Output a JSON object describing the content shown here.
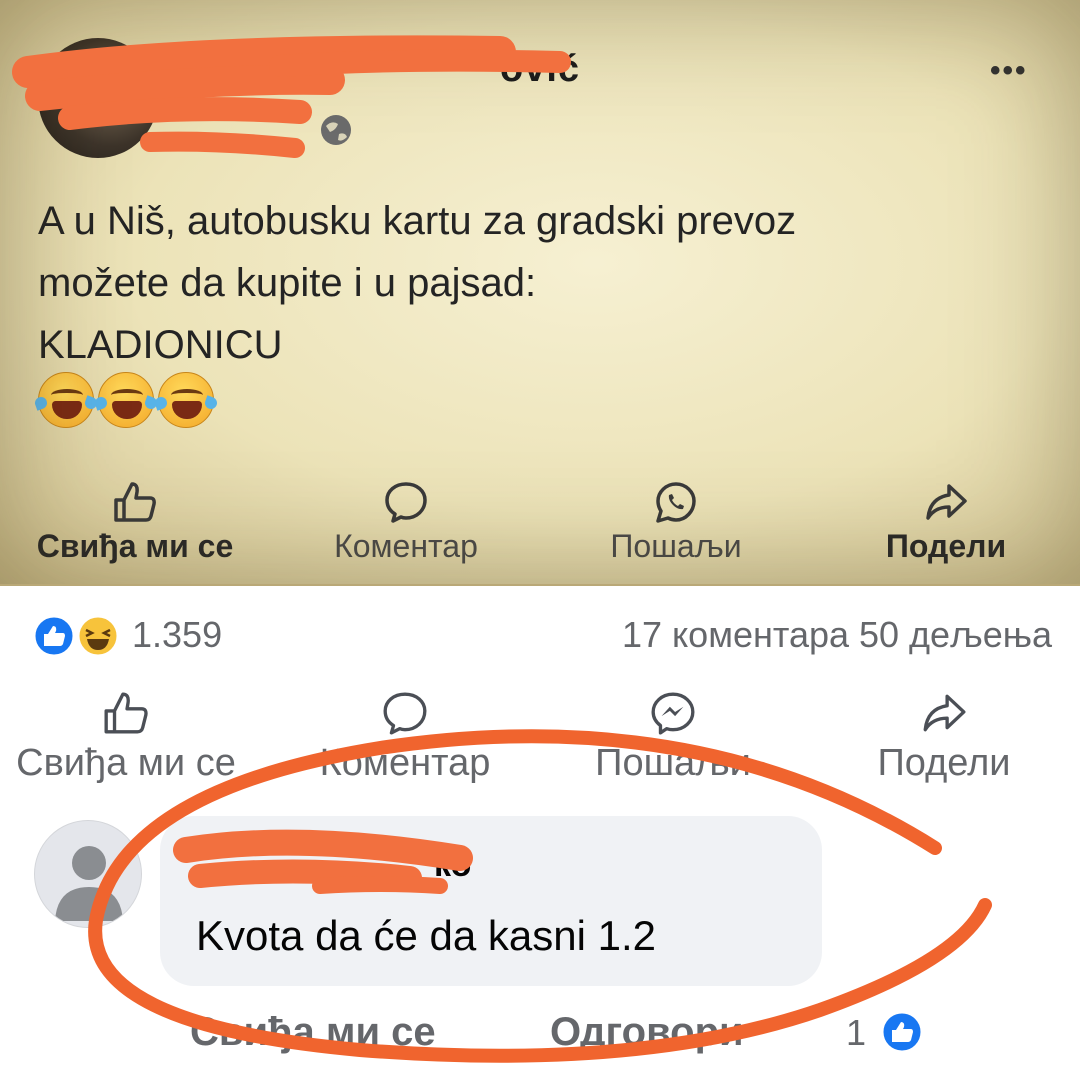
{
  "embedded_post": {
    "author_name_suffix": "ović",
    "text_lines": [
      "A u Niš, autobusku kartu za gradski prevoz",
      "možete da kupite i u pajsad:",
      "KLADIONICU"
    ],
    "actions": [
      {
        "label": "Свиђа ми се",
        "icon": "thumbs-up-icon"
      },
      {
        "label": "Коментар",
        "icon": "comment-icon"
      },
      {
        "label": "Пошаљи",
        "icon": "whatsapp-icon"
      },
      {
        "label": "Подели",
        "icon": "share-icon"
      }
    ],
    "emojis": [
      "laughing-tears-emoji",
      "laughing-tears-emoji",
      "laughing-tears-emoji"
    ]
  },
  "stats": {
    "reactions_count": "1.359",
    "comments_shares": "17 коментара  50 дељења",
    "reaction_icons": [
      "like-reaction-icon",
      "haha-reaction-icon"
    ]
  },
  "actions": [
    {
      "label": "Свиђа ми се",
      "icon": "thumbs-up-icon"
    },
    {
      "label": "Коментар",
      "icon": "comment-icon"
    },
    {
      "label": "Пошаљи",
      "icon": "messenger-icon"
    },
    {
      "label": "Подели",
      "icon": "share-icon"
    }
  ],
  "comment": {
    "author_name_suffix": "ко",
    "text": "Kvota da će da kasni 1.2",
    "like_link": "Свиђа ми се",
    "reply_link": "Одговори",
    "reaction_count": "1"
  },
  "colors": {
    "redaction": "#f2703f",
    "facebook_blue": "#1877f2",
    "secondary_text": "#65676b",
    "bubble": "#f0f2f5"
  }
}
